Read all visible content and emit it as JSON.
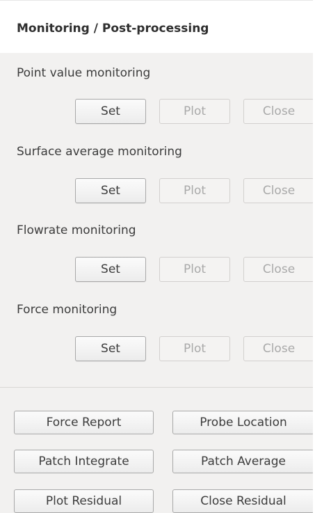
{
  "header": {
    "title": "Monitoring / Post-processing"
  },
  "sections": [
    {
      "label": "Point value monitoring",
      "set": "Set",
      "plot": "Plot",
      "close": "Close"
    },
    {
      "label": "Surface average monitoring",
      "set": "Set",
      "plot": "Plot",
      "close": "Close"
    },
    {
      "label": "Flowrate monitoring",
      "set": "Set",
      "plot": "Plot",
      "close": "Close"
    },
    {
      "label": "Force monitoring",
      "set": "Set",
      "plot": "Plot",
      "close": "Close"
    }
  ],
  "actions": {
    "force_report": "Force Report",
    "probe_location": "Probe Location",
    "patch_integrate": "Patch Integrate",
    "patch_average": "Patch Average",
    "plot_residual": "Plot Residual",
    "close_residual": "Close Residual"
  }
}
